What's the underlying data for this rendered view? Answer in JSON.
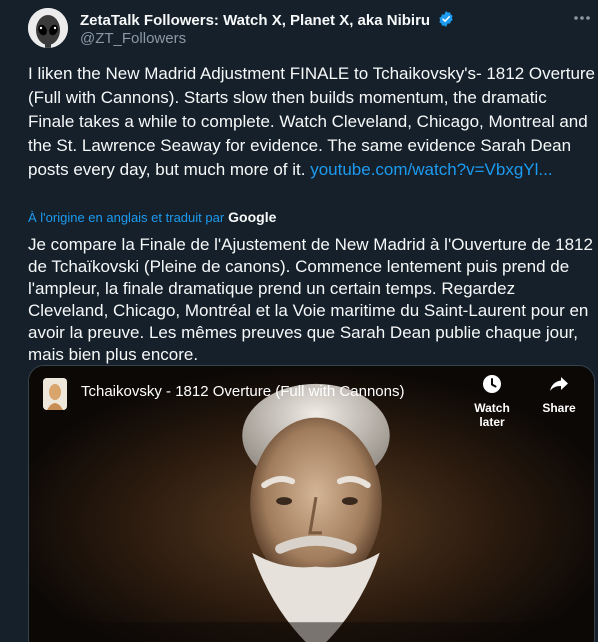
{
  "author": {
    "name": "ZetaTalk Followers: Watch X, Planet X, aka Nibiru",
    "handle": "@ZT_Followers",
    "verified_color": "#1d9bf0"
  },
  "more_icon": "more-horizontal-icon",
  "tweet": {
    "text": "I liken the New Madrid Adjustment FINALE to Tchaikovsky's- 1812 Overture (Full with Cannons).  Starts slow then builds momentum, the dramatic Finale takes a while to complete.  Watch Cleveland, Chicago, Montreal and the St. Lawrence Seaway for evidence.  The same evidence Sarah Dean posts every day, but much more of it. ",
    "link": "youtube.com/watch?v=VbxgYl..."
  },
  "translation": {
    "label": "À l'origine en anglais et traduit par",
    "provider": "Google",
    "text": "Je compare la Finale de l'Ajustement de New Madrid à l'Ouverture de 1812 de Tchaïkovski (Pleine de canons). Commence lentement puis prend de l'ampleur, la finale dramatique prend un certain temps. Regardez Cleveland, Chicago, Montréal et la Voie maritime du Saint-Laurent pour en avoir la preuve. Les mêmes preuves que Sarah Dean publie chaque jour, mais bien plus encore."
  },
  "video": {
    "title": "Tchaikovsky - 1812 Overture (Full with Cannons)",
    "watch_later": "Watch later",
    "share": "Share"
  },
  "colors": {
    "background": "#15202b",
    "link": "#1d9bf0",
    "secondary_text": "#8b98a5"
  }
}
